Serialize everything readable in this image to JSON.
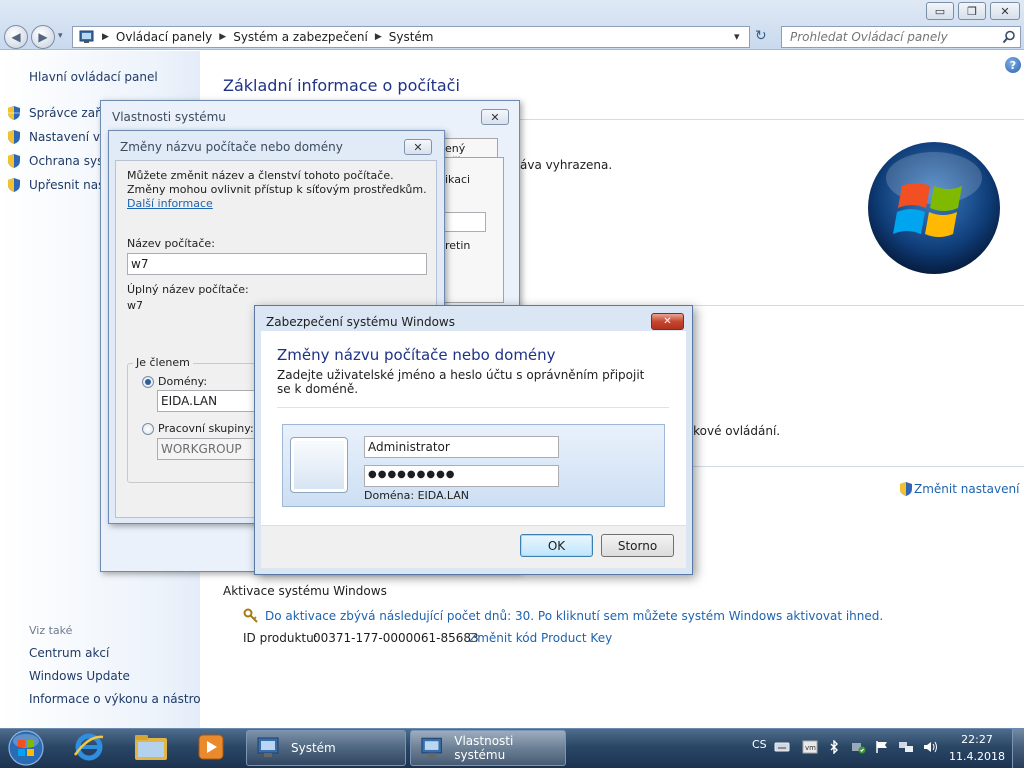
{
  "window": {
    "controls": {
      "minimize": "▭",
      "maximize": "❐",
      "close": "✕"
    },
    "nav": {
      "back": "◀",
      "forward": "▶",
      "recent": "▾"
    }
  },
  "address": {
    "arrow": "▶",
    "crumbs": [
      "Ovládací panely",
      "Systém a zabezpečení",
      "Systém"
    ],
    "dropdown": "▾",
    "refresh": "↻"
  },
  "search": {
    "placeholder": "Prohledat Ovládací panely",
    "icon": "search-icon"
  },
  "help": "?",
  "sidebar": {
    "home": "Hlavní ovládací panel",
    "items": [
      "Správce zaříz",
      "Nastavení vzd",
      "Ochrana syste",
      "Upřesnit nasta"
    ],
    "see_also_title": "Viz také",
    "see_also": [
      "Centrum akcí",
      "Windows Update",
      "Informace o výkonu a nástroje"
    ]
  },
  "main": {
    "title": "Základní informace o počítači",
    "partial_rights": "áva vyhrazena.",
    "partial_remote": "ýkové ovládání.",
    "change_settings": "Změnit nastavení",
    "activation_header": "Aktivace systému Windows",
    "activation_text": "Do aktivace zbývá následující počet dnů: 30. Po kliknutí sem můžete systém Windows aktivovat ihned.",
    "product_id_label": "ID produktu:",
    "product_id": "00371-177-0000061-85683",
    "change_key": "Změnit kód Product Key"
  },
  "sysprops": {
    "title": "Vlastnosti systému",
    "close": "✕",
    "tab_partial": "ený přístup",
    "partial_1": "ikaci",
    "partial_2": "retin"
  },
  "rename": {
    "title": "Změny názvu počítače nebo domény",
    "close": "✕",
    "intro": "Můžete změnit název a členství tohoto počítače. Změny mohou ovlivnit přístup k síťovým prostředkům.",
    "more_info": "Další informace",
    "computer_name_label": "Název počítače:",
    "computer_name": "w7",
    "full_name_label": "Úplný název počítače:",
    "full_name": "w7",
    "member_of": "Je členem",
    "domain_label": "Domény:",
    "domain_value": "EIDA.LAN",
    "workgroup_label": "Pracovní skupiny:",
    "workgroup_value": "WORKGROUP",
    "selected": "domain"
  },
  "security": {
    "title": "Zabezpečení systému Windows",
    "close": "✕",
    "heading": "Změny názvu počítače nebo domény",
    "prompt": "Zadejte uživatelské jméno a heslo účtu s oprávněním připojit se k doméně.",
    "username": "Administrator",
    "password": "●●●●●●●●●",
    "domain_line": "Doména: EIDA.LAN",
    "ok": "OK",
    "cancel": "Storno"
  },
  "taskbar": {
    "tasks": [
      "Systém",
      "Vlastnosti systému"
    ],
    "lang": "CS",
    "time": "22:27",
    "date": "11.4.2018"
  },
  "colors": {
    "link": "#1e63b0",
    "title_blue": "#1e3287",
    "taskbar": "#24405f"
  }
}
